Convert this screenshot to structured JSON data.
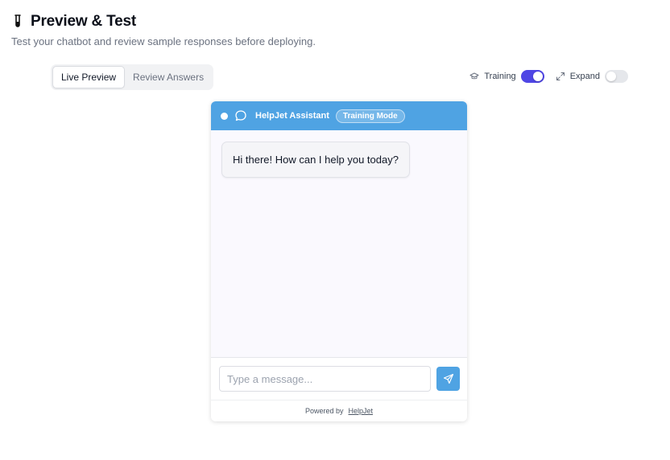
{
  "page": {
    "title": "Preview & Test",
    "subtitle": "Test your chatbot and review sample responses before deploying.",
    "title_icon": "test-tube-icon"
  },
  "tabs": [
    {
      "label": "Live Preview",
      "active": true
    },
    {
      "label": "Review Answers",
      "active": false
    }
  ],
  "toggles": {
    "training": {
      "label": "Training",
      "icon": "graduation-cap-icon",
      "on": true
    },
    "expand": {
      "label": "Expand",
      "icon": "expand-icon",
      "on": false
    }
  },
  "chat": {
    "assistant_name": "HelpJet Assistant",
    "mode_badge": "Training Mode",
    "messages": [
      {
        "from": "bot",
        "text": "Hi there! How can I help you today?"
      }
    ],
    "input_placeholder": "Type a message...",
    "input_value": "",
    "footer_prefix": "Powered by",
    "footer_brand": "HelpJet"
  },
  "colors": {
    "accent": "#4fa3e3",
    "toggle_on": "#4f46e5",
    "toggle_off": "#e5e7eb"
  }
}
